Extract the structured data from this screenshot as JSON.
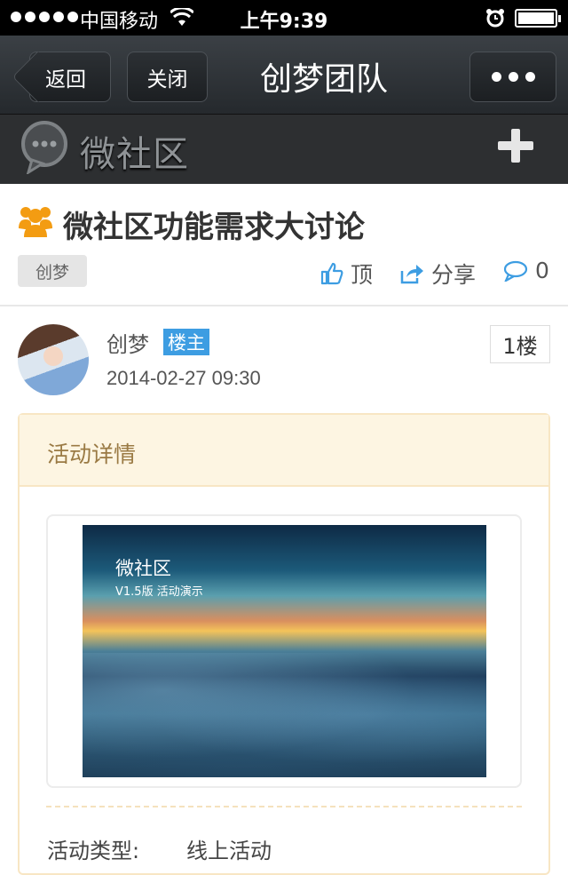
{
  "status_bar": {
    "carrier": "中国移动",
    "time": "上午9:39"
  },
  "nav": {
    "back_label": "返回",
    "close_label": "关闭",
    "title": "创梦团队"
  },
  "community": {
    "logo_text": "微社区"
  },
  "topic": {
    "title": "微社区功能需求大讨论",
    "tag": "创梦",
    "actions": {
      "top_label": "顶",
      "share_label": "分享",
      "comment_count": "0"
    }
  },
  "post": {
    "author": "创梦",
    "owner_badge": "楼主",
    "date": "2014-02-27 09:30",
    "floor": "1楼"
  },
  "activity": {
    "header": "活动详情",
    "image_title": "微社区",
    "image_subtitle": "V1.5版 活动演示",
    "type_label": "活动类型:",
    "type_value": "线上活动"
  },
  "colors": {
    "accent_blue": "#3d9de2",
    "group_icon_orange": "#f39c12",
    "card_border": "#f8e6c4"
  }
}
